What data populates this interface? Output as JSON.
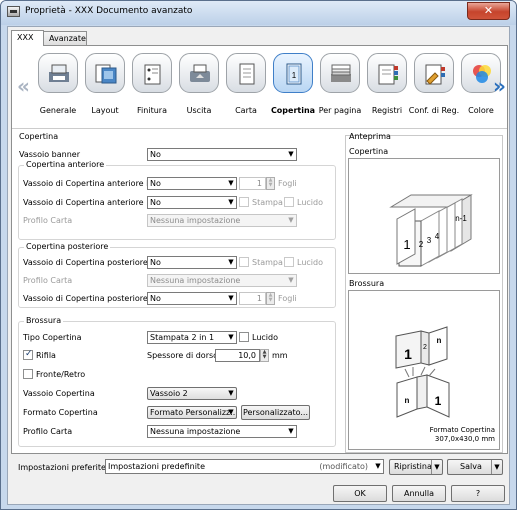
{
  "window": {
    "title": "Proprietà - XXX Documento avanzato",
    "close_label": "✕"
  },
  "tabs": [
    {
      "label": "XXX"
    },
    {
      "label": "Avanzate"
    }
  ],
  "toolbar": [
    {
      "label": "Generale",
      "icon": "general-icon"
    },
    {
      "label": "Layout",
      "icon": "layout-icon"
    },
    {
      "label": "Finitura",
      "icon": "finishing-icon"
    },
    {
      "label": "Uscita",
      "icon": "output-icon"
    },
    {
      "label": "Carta",
      "icon": "paper-icon"
    },
    {
      "label": "Copertina",
      "icon": "cover-icon",
      "selected": true
    },
    {
      "label": "Per pagina",
      "icon": "per-page-icon"
    },
    {
      "label": "Registri",
      "icon": "tabs-icon"
    },
    {
      "label": "Conf. di Reg.",
      "icon": "tab-settings-icon"
    },
    {
      "label": "Colore",
      "icon": "color-icon"
    }
  ],
  "copertina": {
    "section_label": "Copertina",
    "banner": {
      "label": "Vassoio banner",
      "value": "No"
    },
    "front": {
      "title": "Copertina anteriore",
      "pi": {
        "label": "Vassoio di Copertina anteriore PI",
        "value": "No",
        "sheets_value": "1",
        "sheets_unit": "Fogli"
      },
      "tray": {
        "label": "Vassoio di Copertina anteriore",
        "value": "No",
        "print_label": "Stampa",
        "gloss_label": "Lucido"
      },
      "profile": {
        "label": "Profilo Carta",
        "value": "Nessuna impostazione"
      }
    },
    "back": {
      "title": "Copertina posteriore",
      "tray": {
        "label": "Vassoio di Copertina posteriore",
        "value": "No",
        "print_label": "Stampa",
        "gloss_label": "Lucido"
      },
      "profile": {
        "label": "Profilo Carta",
        "value": "Nessuna impostazione"
      },
      "pi": {
        "label": "Vassoio di Copertina posteriore PI",
        "value": "No",
        "sheets_value": "1",
        "sheets_unit": "Fogli"
      }
    },
    "booklet": {
      "title": "Brossura",
      "cover_type": {
        "label": "Tipo Copertina",
        "value": "Stampata 2 in 1",
        "gloss_label": "Lucido"
      },
      "trim": {
        "label": "Rifila",
        "checked": true
      },
      "spine": {
        "label": "Spessore di dorso",
        "value": "10,0",
        "unit": "mm"
      },
      "duplex": {
        "label": "Fronte/Retro",
        "checked": false
      },
      "tray": {
        "label": "Vassoio Copertina",
        "value": "Vassoio 2"
      },
      "format": {
        "label": "Formato Copertina",
        "value": "Formato Personalizz...",
        "button": "Personalizzato..."
      },
      "profile": {
        "label": "Profilo Carta",
        "value": "Nessuna impostazione"
      }
    }
  },
  "preview": {
    "title": "Anteprima",
    "cover_label": "Copertina",
    "booklet_label": "Brossura",
    "format_caption": "Formato Copertina",
    "format_size": "307,0x430,0 mm",
    "page_marks": [
      "1",
      "2",
      "3",
      "4",
      "n-1",
      "n"
    ]
  },
  "footer": {
    "favorites_label": "Impostazioni preferite",
    "favorites_value": "Impostazioni predefinite",
    "modified": "(modificato)",
    "restore": "Ripristina",
    "save": "Salva",
    "ok": "OK",
    "cancel": "Annulla",
    "help": "?"
  }
}
